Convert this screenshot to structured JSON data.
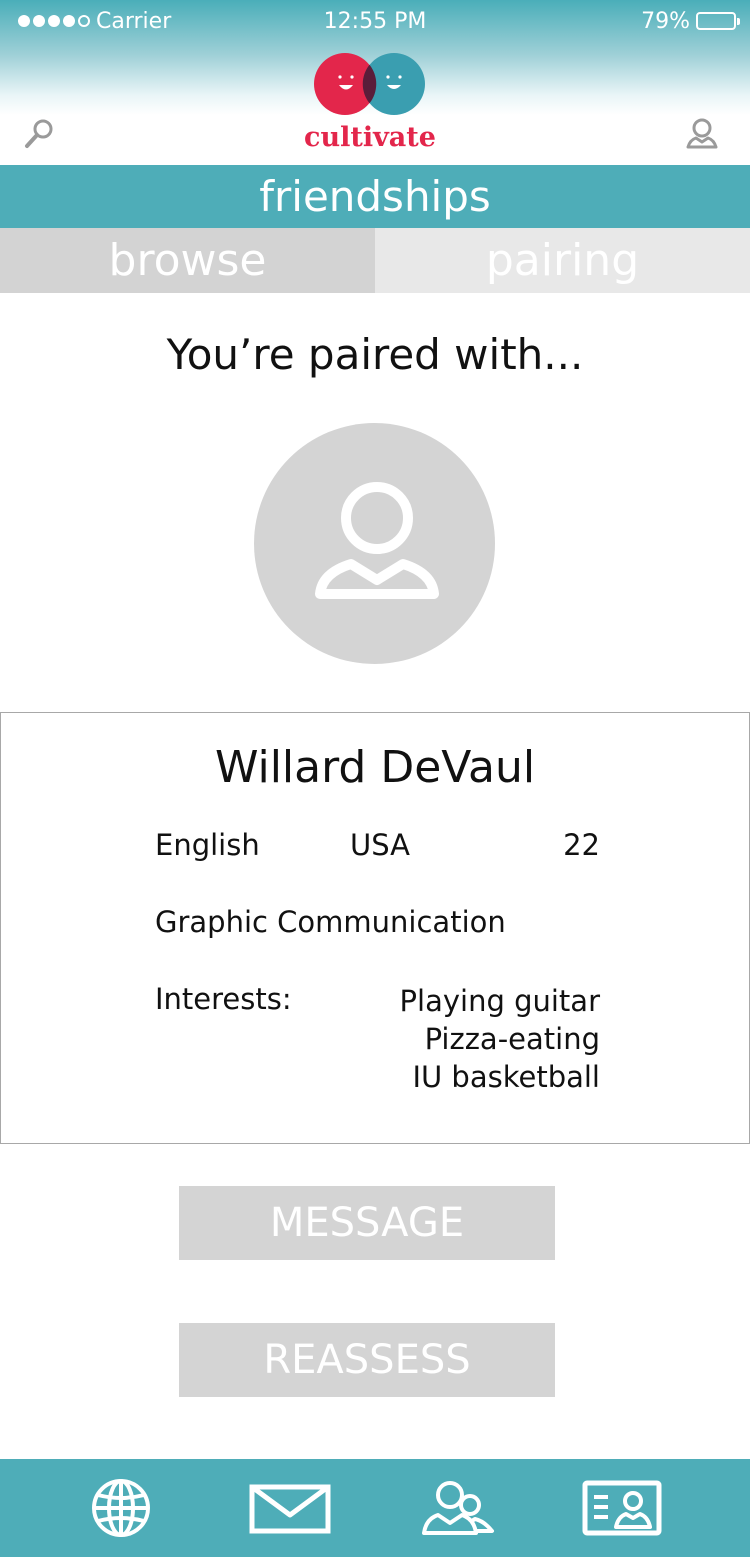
{
  "status_bar": {
    "carrier": "Carrier",
    "time": "12:55 PM",
    "battery_percent": "79%",
    "battery_level": 0.79
  },
  "app": {
    "logo_text": "cultivate",
    "brand_color": "#e3264b",
    "accent_color": "#4eadb8"
  },
  "header": {
    "left_icon": "search-icon",
    "right_icon": "profile-icon"
  },
  "section": {
    "title": "friendships"
  },
  "tabs": [
    {
      "label": "browse",
      "selected": false
    },
    {
      "label": "pairing",
      "selected": true
    }
  ],
  "pairing": {
    "heading": "You’re paired with...",
    "avatar_icon": "user-avatar-icon"
  },
  "profile": {
    "name": "Willard DeVaul",
    "language": "English",
    "country": "USA",
    "age": "22",
    "major": "Graphic Communication",
    "interests_label": "Interests:",
    "interests": [
      "Playing guitar",
      "Pizza-eating",
      "IU basketball"
    ]
  },
  "actions": {
    "message_label": "MESSAGE",
    "reassess_label": "REASSESS"
  },
  "bottom_nav": [
    {
      "icon": "globe-icon"
    },
    {
      "icon": "mail-icon"
    },
    {
      "icon": "friends-icon"
    },
    {
      "icon": "id-card-icon"
    }
  ]
}
